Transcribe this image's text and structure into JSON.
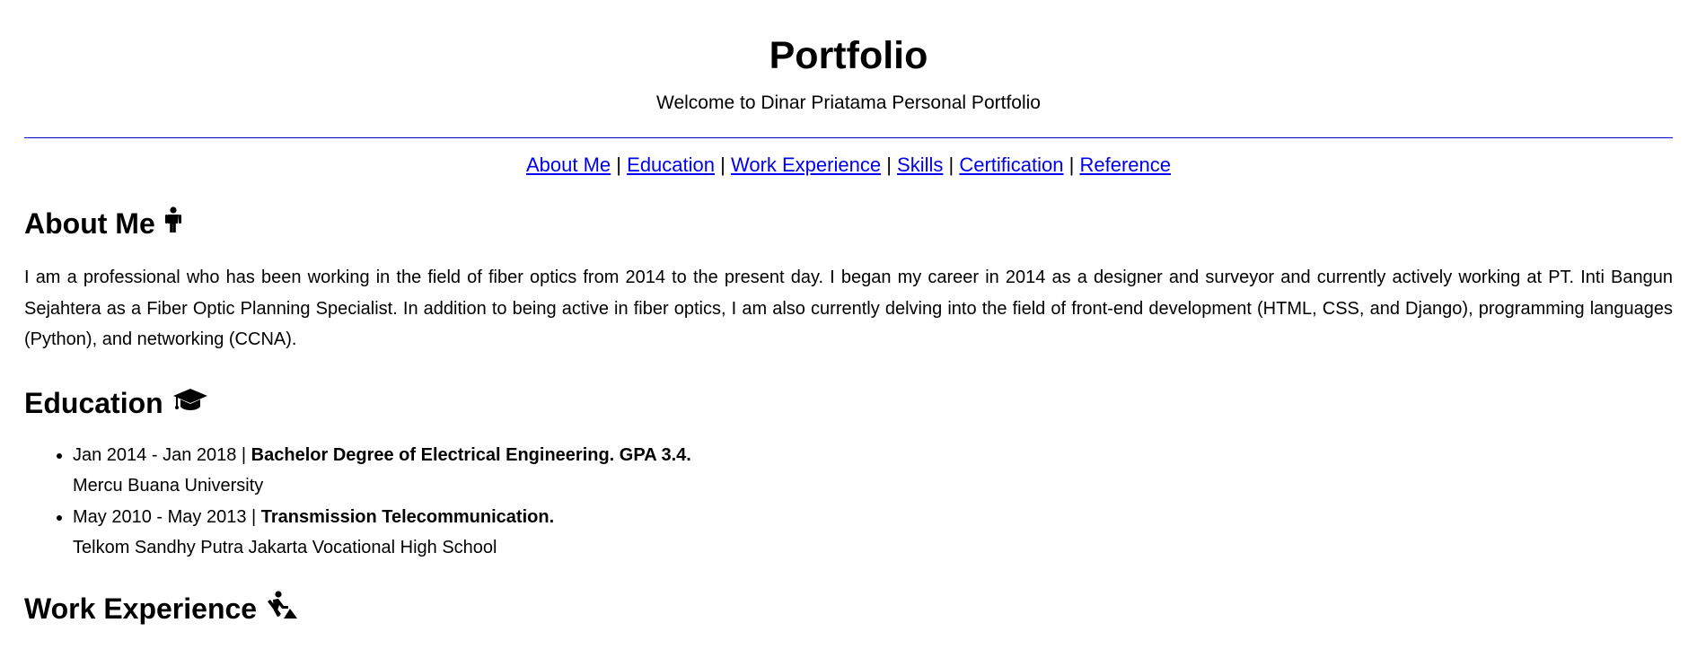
{
  "header": {
    "title": "Portfolio",
    "subtitle": "Welcome to Dinar Priatama Personal Portfolio"
  },
  "nav": {
    "separator": "|",
    "links": [
      {
        "label": "About Me"
      },
      {
        "label": "Education"
      },
      {
        "label": "Work Experience"
      },
      {
        "label": "Skills"
      },
      {
        "label": "Certification"
      },
      {
        "label": "Reference"
      }
    ]
  },
  "about": {
    "heading": "About Me",
    "icon": "person-standing-icon",
    "text": "I am a professional who has been working in the field of fiber optics from 2014 to the present day. I began my career in 2014 as a designer and surveyor and currently actively working at PT. Inti Bangun Sejahtera as a Fiber Optic Planning Specialist. In addition to being active in fiber optics, I am also currently delving into the field of front-end development (HTML, CSS, and Django), programming languages (Python), and networking (CCNA)."
  },
  "education": {
    "heading": "Education",
    "icon": "graduation-cap-icon",
    "items": [
      {
        "period": "Jan 2014 - Jan 2018 | ",
        "degree": "Bachelor Degree of Electrical Engineering. GPA 3.4.",
        "institution": "Mercu Buana University"
      },
      {
        "period": "May 2010 - May 2013 | ",
        "degree": "Transmission Telecommunication.",
        "institution": "Telkom Sandhy Putra Jakarta Vocational High School"
      }
    ]
  },
  "work": {
    "heading": "Work Experience",
    "icon": "person-digging-icon"
  }
}
